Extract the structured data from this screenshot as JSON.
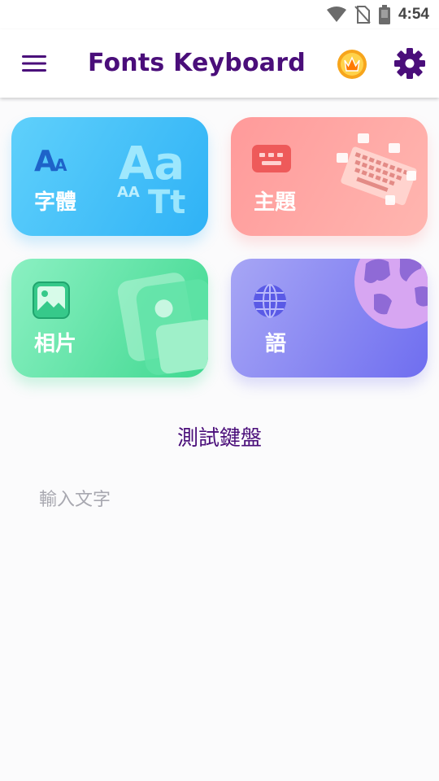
{
  "status_bar": {
    "time": "4:54",
    "icons": [
      "wifi-icon",
      "no-sim-icon",
      "battery-icon"
    ]
  },
  "app_bar": {
    "title": "Fonts Keyboard",
    "menu_icon": "menu-icon",
    "premium_icon": "crown-icon",
    "settings_icon": "gear-icon"
  },
  "cards": [
    {
      "label": "字體",
      "icon": "font-icon",
      "color": "#2fb2f6"
    },
    {
      "label": "主題",
      "icon": "keyboard-icon",
      "color": "#ff9a9a"
    },
    {
      "label": "相片",
      "icon": "image-icon",
      "color": "#3fd890"
    },
    {
      "label": "語",
      "icon": "globe-icon",
      "color": "#6f6ef0"
    }
  ],
  "cards_art": {
    "fonts_big": "Aa",
    "fonts_small": "AA",
    "fonts_tt": "Tt"
  },
  "test_section": {
    "title": "測試鍵盤",
    "input_placeholder": "輸入文字",
    "input_value": ""
  },
  "colors": {
    "accent": "#4a0e7a",
    "background": "#fbfbfc"
  }
}
